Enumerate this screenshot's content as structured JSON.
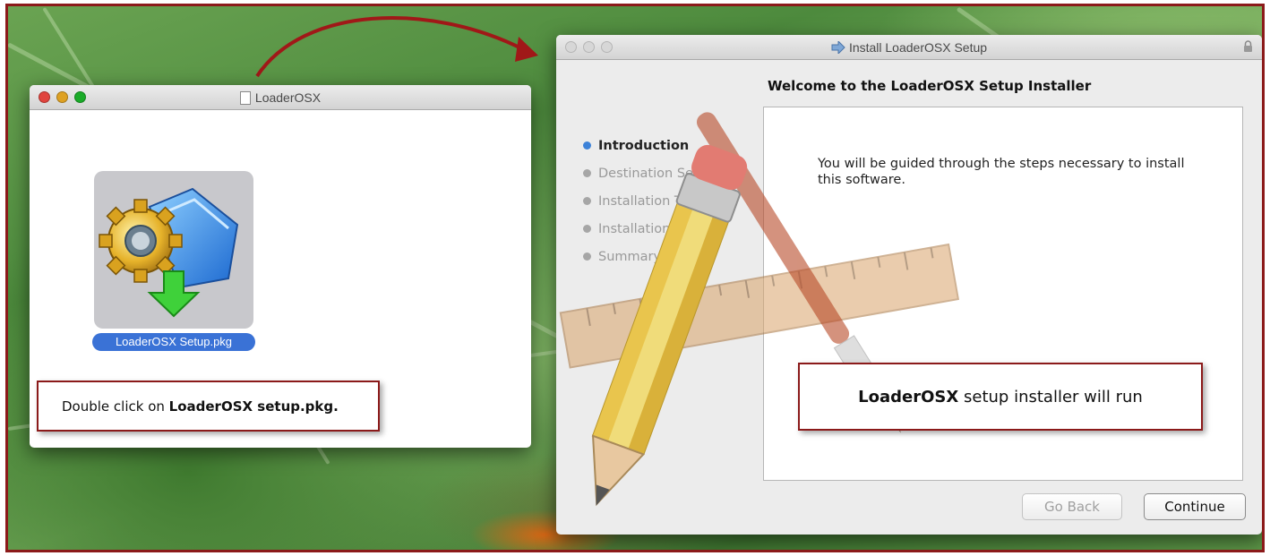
{
  "finder_window": {
    "title": "LoaderOSX",
    "package_label": "LoaderOSX Setup.pkg",
    "callout": {
      "prefix": "Double click on ",
      "emphasis": "LoaderOSX setup.pkg."
    }
  },
  "installer_window": {
    "title": "Install LoaderOSX Setup",
    "heading": "Welcome to the LoaderOSX Setup Installer",
    "steps": [
      {
        "label": "Introduction",
        "active": true
      },
      {
        "label": "Destination Select",
        "active": false
      },
      {
        "label": "Installation Type",
        "active": false
      },
      {
        "label": "Installation",
        "active": false
      },
      {
        "label": "Summary",
        "active": false
      }
    ],
    "body_text": "You will be guided through the steps necessary to install this software.",
    "callout": {
      "emphasis": "LoaderOSX",
      "suffix": " setup installer will run"
    },
    "buttons": {
      "back": "Go Back",
      "continue": "Continue"
    }
  },
  "colors": {
    "callout_border": "#8b1a1a",
    "selection_blue": "#3a72d6",
    "active_step": "#3d82d8",
    "close_red": "#e0443e",
    "minimize_yellow": "#dea123",
    "zoom_green": "#1aab29"
  },
  "icons": [
    "package-installer-icon",
    "lock-icon",
    "document-icon",
    "installer-arrow-icon",
    "pencil-ruler-art"
  ]
}
